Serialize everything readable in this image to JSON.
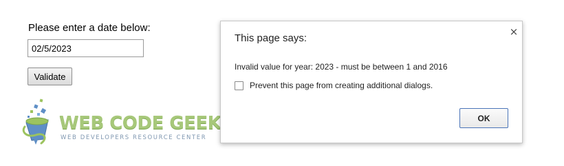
{
  "form": {
    "prompt": "Please enter a date below:",
    "date_value": "02/5/2023",
    "validate_label": "Validate"
  },
  "logo": {
    "title": "WEB CODE GEEKS",
    "subtitle": "WEB DEVELOPERS RESOURCE CENTER",
    "colors": {
      "title": "#a7c87a",
      "subtitle": "#7f97b0",
      "mark_blue": "#5f8fc6",
      "mark_green": "#9cc35f"
    }
  },
  "dialog": {
    "title": "This page says:",
    "close_glyph": "×",
    "message": "Invalid value for year: 2023 - must be between 1 and 2016",
    "suppress_label": "Prevent this page from creating additional dialogs.",
    "suppress_checked": false,
    "ok_label": "OK"
  },
  "icons": [
    "close-icon",
    "web-code-geeks-logo-mark"
  ]
}
